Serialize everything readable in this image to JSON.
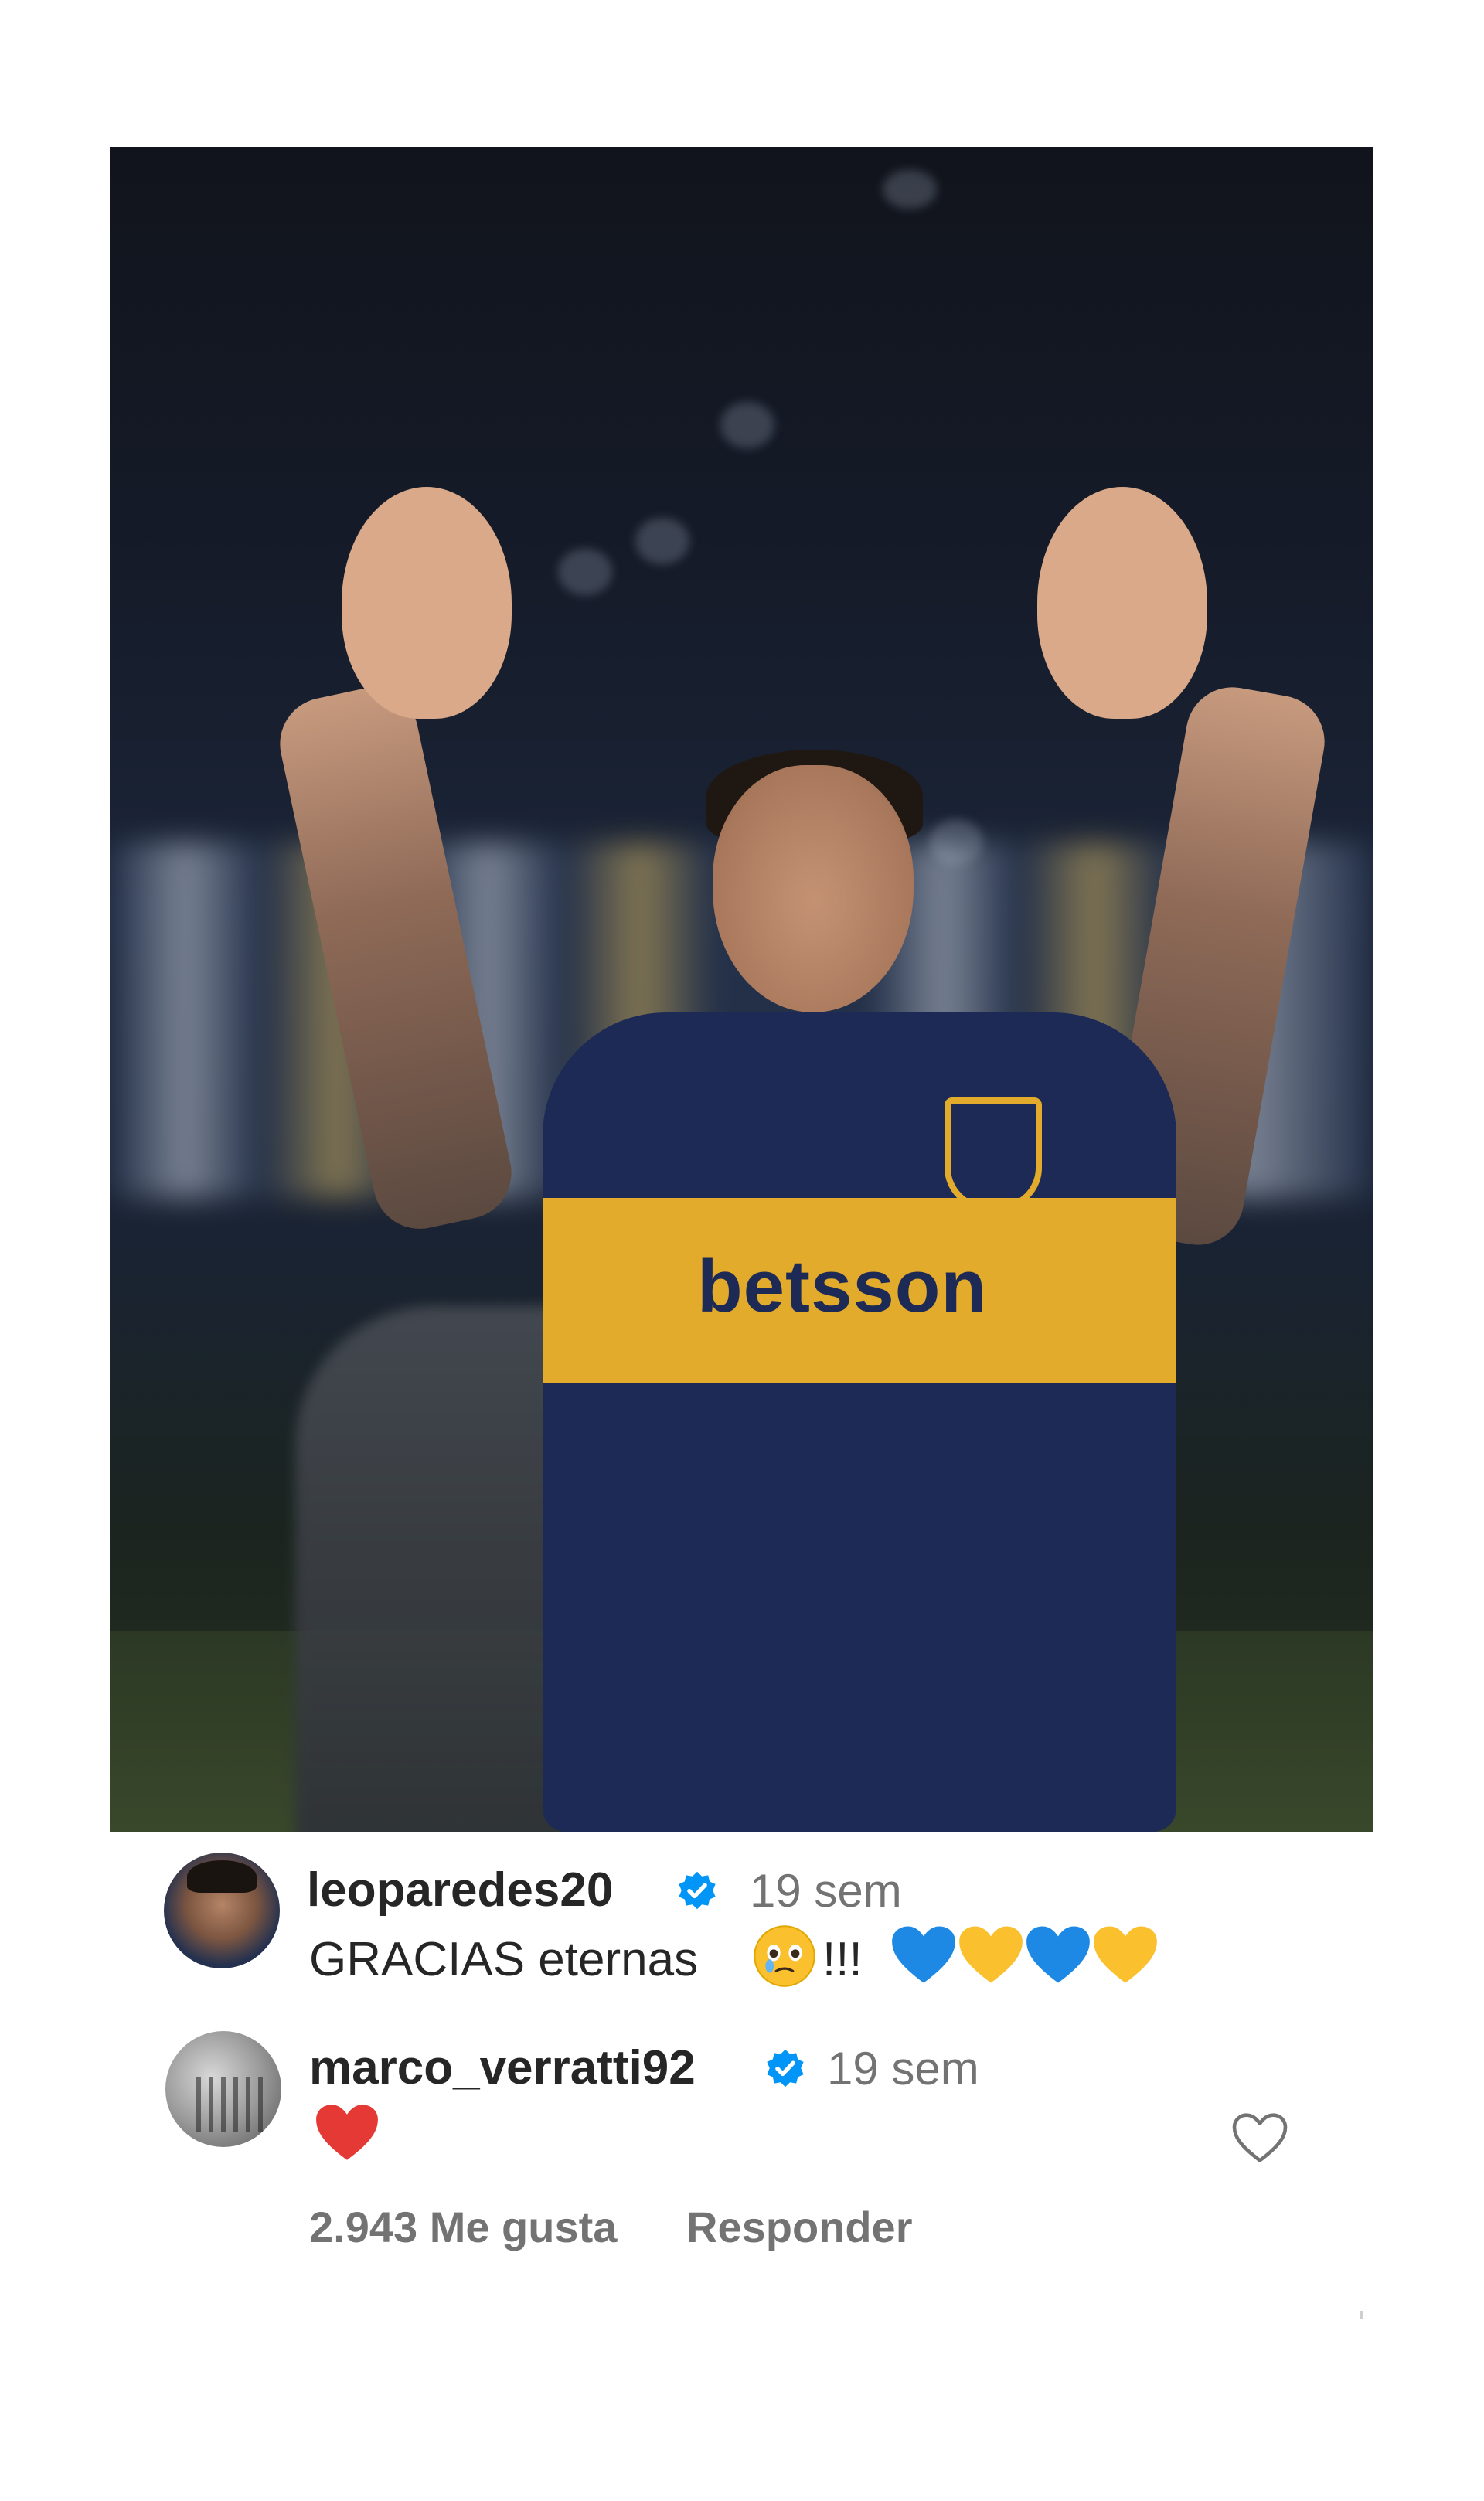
{
  "post": {
    "photo_alt_icon": "post-photo"
  },
  "comments": [
    {
      "username": "leoparedes20",
      "verified": true,
      "time": "19 sem",
      "text": "GRACIAS eternas",
      "suffix": "!!!",
      "emojis": [
        "crying-face-emoji",
        "blue-heart-emoji",
        "yellow-heart-emoji",
        "blue-heart-emoji",
        "yellow-heart-emoji"
      ]
    },
    {
      "username": "marco_verratti92",
      "verified": true,
      "time": "19 sem",
      "emojis": [
        "red-heart-emoji"
      ],
      "likes_label": "2.943 Me gusta",
      "reply_label": "Responder"
    }
  ],
  "colors": {
    "verified_badge": "#0095f6",
    "secondary_text": "#737373",
    "primary_text": "#262626",
    "blue_heart": "#1e88e5",
    "yellow_heart": "#fbc02d",
    "red_heart": "#e53935"
  }
}
